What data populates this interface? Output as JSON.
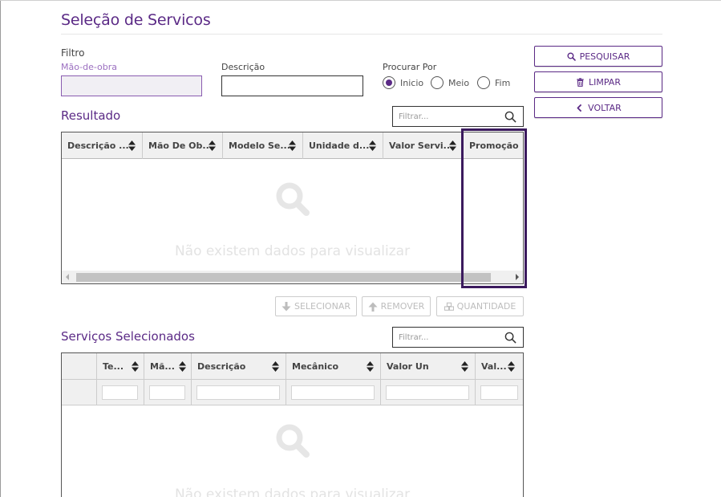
{
  "page": {
    "title": "Seleção de Servicos"
  },
  "filtro": {
    "label": "Filtro",
    "mao_de_obra": {
      "label": "Mão-de-obra",
      "value": ""
    },
    "descricao": {
      "label": "Descrição",
      "value": ""
    },
    "procurar_por": {
      "label": "Procurar Por",
      "options": [
        {
          "label": "Inicio",
          "selected": true
        },
        {
          "label": "Meio",
          "selected": false
        },
        {
          "label": "Fim",
          "selected": false
        }
      ]
    }
  },
  "actions": {
    "pesquisar": "PESQUISAR",
    "limpar": "LIMPAR",
    "voltar": "VOLTAR"
  },
  "resultado": {
    "title": "Resultado",
    "filter_placeholder": "Filtrar...",
    "columns": [
      "Descrição ...",
      "Mão De Ob...",
      "Modelo Se...",
      "Unidade d...",
      "Valor Servi...",
      "Promoção"
    ],
    "empty_text": "Não existem dados para visualizar"
  },
  "grid_buttons": {
    "selecionar": "SELECIONAR",
    "remover": "REMOVER",
    "quantidade": "QUANTIDADE"
  },
  "selecionados": {
    "title": "Serviços Selecionados",
    "filter_placeholder": "Filtrar...",
    "columns": [
      "",
      "Te...",
      "Mã...",
      "Descrição",
      "Mecânico",
      "Valor Un",
      "Val..."
    ],
    "empty_text": "Não existem dados para visualizar"
  },
  "colors": {
    "accent": "#5b2a86",
    "highlight": "#3b1a5e"
  },
  "icons": [
    "search-icon",
    "trash-icon",
    "chevron-left-icon",
    "arrow-down-icon",
    "arrow-up-icon",
    "cubes-icon",
    "sort-icon"
  ]
}
